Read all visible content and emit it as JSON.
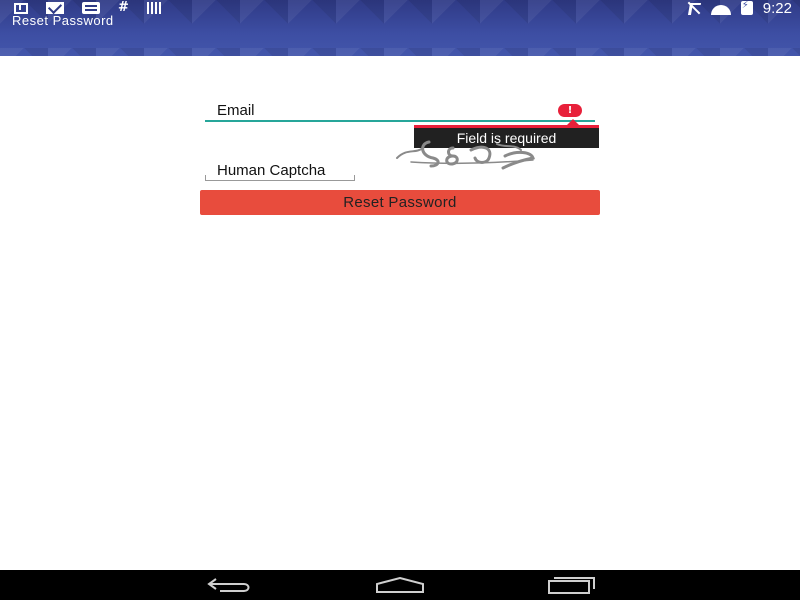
{
  "status_bar": {
    "time": "9:22",
    "left_icons": [
      "download-icon",
      "gmail-icon",
      "news-icon",
      "hash-icon",
      "barcode-icon"
    ],
    "hash_glyph": "#",
    "right_icons": [
      "mute-icon",
      "wifi-icon",
      "battery-charging-icon"
    ]
  },
  "app_bar": {
    "title": "Reset Password",
    "background_color": "#3d4ea3"
  },
  "form": {
    "email": {
      "placeholder": "Email",
      "value": ""
    },
    "error": {
      "icon_glyph": "!",
      "message": "Field is required",
      "color": "#e8203a"
    },
    "captcha_image": "captcha-image",
    "captcha_input": {
      "placeholder": "Human Captcha",
      "value": ""
    },
    "submit_label": "Reset Password",
    "submit_color": "#e84c3d"
  },
  "nav_bar": {
    "buttons": [
      "back-icon",
      "home-icon",
      "recent-apps-icon"
    ]
  }
}
